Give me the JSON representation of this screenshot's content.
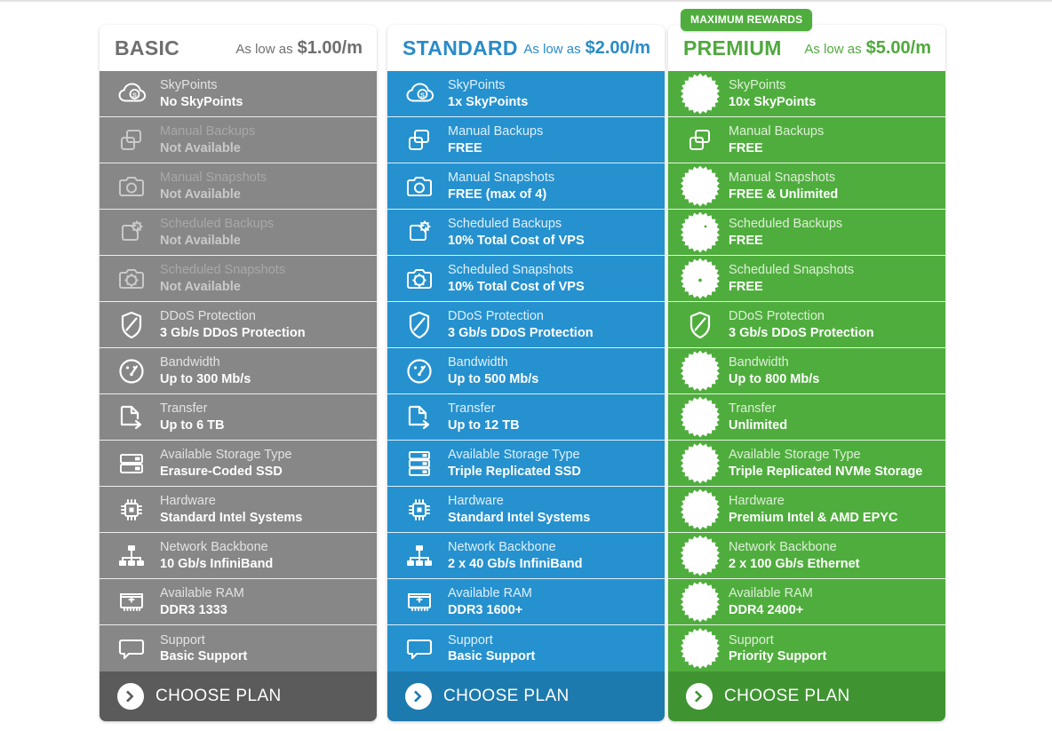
{
  "page": {
    "title": "VPS Plan Comparison",
    "colors": {
      "basic": "#878787",
      "basic_button": "#5b5b5b",
      "basic_text": "#6f6f6f",
      "standard": "#2591cf",
      "standard_button": "#1d7aae",
      "standard_text": "#2a8bc8",
      "premium": "#4fad3d",
      "premium_button": "#3f9431",
      "premium_text": "#4fa93d",
      "card_header_bg": "#ffffff",
      "page_bg": "#ffffff"
    }
  },
  "plans": [
    {
      "id": "basic",
      "name": "BASIC",
      "badge": null,
      "price_prefix": "As low as",
      "price": "$1.00/m",
      "cta_label": "CHOOSE PLAN",
      "features": [
        {
          "icon": "skypoints-cloud-icon",
          "label": "SkyPoints",
          "value": "No SkyPoints",
          "available": true,
          "highlight": false
        },
        {
          "icon": "manual-backups-icon",
          "label": "Manual Backups",
          "value": "Not Available",
          "available": false,
          "highlight": false
        },
        {
          "icon": "manual-snapshots-icon",
          "label": "Manual Snapshots",
          "value": "Not Available",
          "available": false,
          "highlight": false
        },
        {
          "icon": "scheduled-backups-icon",
          "label": "Scheduled Backups",
          "value": "Not Available",
          "available": false,
          "highlight": false
        },
        {
          "icon": "scheduled-snapshots-icon",
          "label": "Scheduled Snapshots",
          "value": "Not Available",
          "available": false,
          "highlight": false
        },
        {
          "icon": "ddos-shield-icon",
          "label": "DDoS Protection",
          "value": "3 Gb/s DDoS Protection",
          "available": true,
          "highlight": false
        },
        {
          "icon": "bandwidth-gauge-icon",
          "label": "Bandwidth",
          "value": "Up to 300 Mb/s",
          "available": true,
          "highlight": false
        },
        {
          "icon": "transfer-icon",
          "label": "Transfer",
          "value": "Up to 6 TB",
          "available": true,
          "highlight": false
        },
        {
          "icon": "storage-server-icon",
          "label": "Available Storage Type",
          "value": "Erasure-Coded SSD",
          "available": true,
          "highlight": false
        },
        {
          "icon": "cpu-chip-icon",
          "label": "Hardware",
          "value": "Standard Intel Systems",
          "available": true,
          "highlight": false
        },
        {
          "icon": "network-backbone-icon",
          "label": "Network Backbone",
          "value": "10 Gb/s InfiniBand",
          "available": true,
          "highlight": false
        },
        {
          "icon": "ram-icon",
          "label": "Available RAM",
          "value": "DDR3 1333",
          "available": true,
          "highlight": false
        },
        {
          "icon": "support-chat-icon",
          "label": "Support",
          "value": "Basic Support",
          "available": true,
          "highlight": false
        }
      ]
    },
    {
      "id": "standard",
      "name": "STANDARD",
      "badge": null,
      "price_prefix": "As low as",
      "price": "$2.00/m",
      "cta_label": "CHOOSE PLAN",
      "features": [
        {
          "icon": "skypoints-cloud-icon",
          "label": "SkyPoints",
          "value": "1x SkyPoints",
          "available": true,
          "highlight": false
        },
        {
          "icon": "manual-backups-icon",
          "label": "Manual Backups",
          "value": "FREE",
          "available": true,
          "highlight": false
        },
        {
          "icon": "manual-snapshots-icon",
          "label": "Manual Snapshots",
          "value": "FREE (max of 4)",
          "available": true,
          "highlight": false
        },
        {
          "icon": "scheduled-backups-icon",
          "label": "Scheduled Backups",
          "value": "10%  Total Cost of VPS",
          "available": true,
          "highlight": false
        },
        {
          "icon": "scheduled-snapshots-icon",
          "label": "Scheduled Snapshots",
          "value": "10%  Total Cost of VPS",
          "available": true,
          "highlight": false
        },
        {
          "icon": "ddos-shield-icon",
          "label": "DDoS Protection",
          "value": "3 Gb/s DDoS Protection",
          "available": true,
          "highlight": false
        },
        {
          "icon": "bandwidth-gauge-icon",
          "label": "Bandwidth",
          "value": "Up to 500 Mb/s",
          "available": true,
          "highlight": false
        },
        {
          "icon": "transfer-icon",
          "label": "Transfer",
          "value": "Up to 12 TB",
          "available": true,
          "highlight": false
        },
        {
          "icon": "storage-server-triple-icon",
          "label": "Available Storage Type",
          "value": "Triple Replicated SSD",
          "available": true,
          "highlight": false
        },
        {
          "icon": "cpu-chip-icon",
          "label": "Hardware",
          "value": "Standard Intel Systems",
          "available": true,
          "highlight": false
        },
        {
          "icon": "network-backbone-icon",
          "label": "Network Backbone",
          "value": "2 x 40 Gb/s InfiniBand",
          "available": true,
          "highlight": false
        },
        {
          "icon": "ram-icon",
          "label": "Available RAM",
          "value": "DDR3 1600+",
          "available": true,
          "highlight": false
        },
        {
          "icon": "support-chat-icon",
          "label": "Support",
          "value": "Basic Support",
          "available": true,
          "highlight": false
        }
      ]
    },
    {
      "id": "premium",
      "name": "PREMIUM",
      "badge": "MAXIMUM REWARDS",
      "price_prefix": "As low as",
      "price": "$5.00/m",
      "cta_label": "CHOOSE PLAN",
      "features": [
        {
          "icon": "skypoints-cloud-icon",
          "label": "SkyPoints",
          "value": "10x SkyPoints",
          "available": true,
          "highlight": true
        },
        {
          "icon": "manual-backups-icon",
          "label": "Manual Backups",
          "value": "FREE",
          "available": true,
          "highlight": false
        },
        {
          "icon": "manual-snapshots-icon",
          "label": "Manual Snapshots",
          "value": "FREE & Unlimited",
          "available": true,
          "highlight": true
        },
        {
          "icon": "scheduled-backups-icon",
          "label": "Scheduled Backups",
          "value": "FREE",
          "available": true,
          "highlight": true
        },
        {
          "icon": "scheduled-snapshots-icon",
          "label": "Scheduled Snapshots",
          "value": "FREE",
          "available": true,
          "highlight": true
        },
        {
          "icon": "ddos-shield-icon",
          "label": "DDoS Protection",
          "value": "3 Gb/s DDoS Protection",
          "available": true,
          "highlight": false
        },
        {
          "icon": "bandwidth-gauge-icon",
          "label": "Bandwidth",
          "value": "Up to 800 Mb/s",
          "available": true,
          "highlight": true
        },
        {
          "icon": "transfer-icon",
          "label": "Transfer",
          "value": "Unlimited",
          "available": true,
          "highlight": true
        },
        {
          "icon": "storage-server-triple-icon",
          "label": "Available Storage Type",
          "value": "Triple Replicated NVMe Storage",
          "available": true,
          "highlight": true
        },
        {
          "icon": "cpu-chip-icon",
          "label": "Hardware",
          "value": "Premium Intel & AMD EPYC",
          "available": true,
          "highlight": true
        },
        {
          "icon": "network-backbone-icon",
          "label": "Network Backbone",
          "value": "2 x 100 Gb/s Ethernet",
          "available": true,
          "highlight": true
        },
        {
          "icon": "ram-icon",
          "label": "Available RAM",
          "value": "DDR4 2400+",
          "available": true,
          "highlight": true
        },
        {
          "icon": "support-chat-icon",
          "label": "Support",
          "value": "Priority Support",
          "available": true,
          "highlight": true
        }
      ]
    }
  ]
}
